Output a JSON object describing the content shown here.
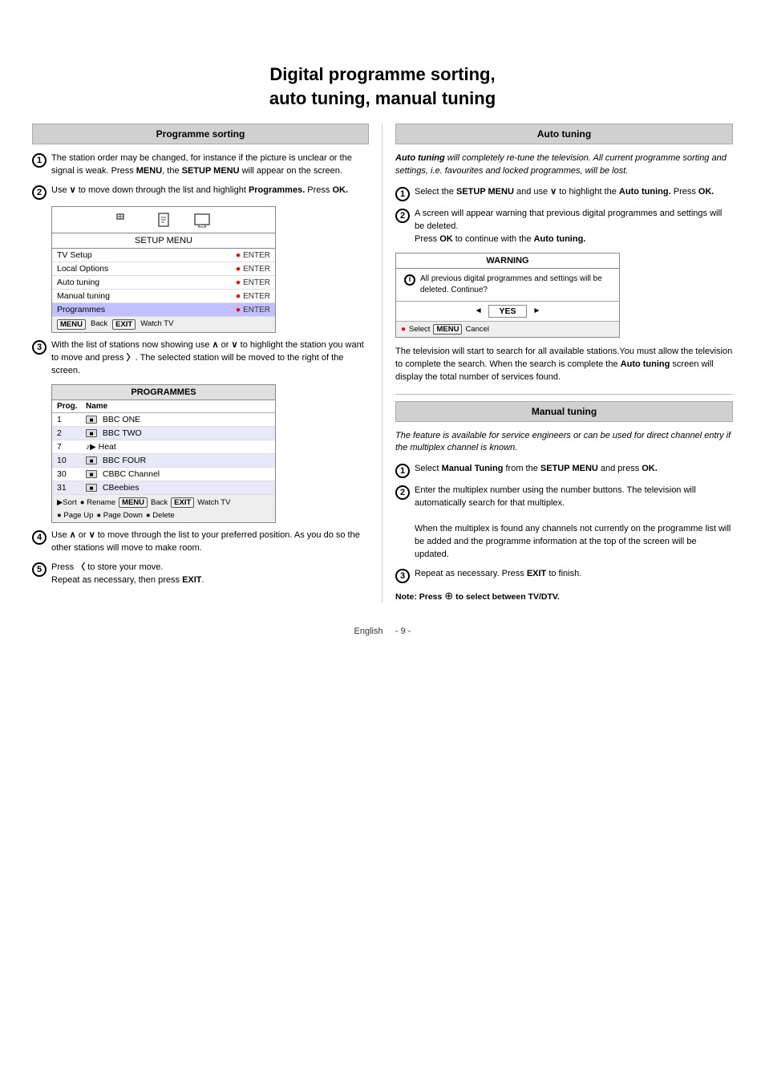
{
  "page": {
    "title_line1": "Digital  programme  sorting,",
    "title_line2": "auto  tuning,  manual  tuning"
  },
  "left_section": {
    "header": "Programme sorting",
    "step1": {
      "text_before": "The station order may be changed, for instance if the picture is unclear or the signal is weak.  Press ",
      "key1": "MENU",
      "text_mid": ", the ",
      "key2": "SETUP MENU",
      "text_after": " will appear on the screen."
    },
    "step2": {
      "text_before": "Use ",
      "chevron": "∨",
      "text_mid": " to move down through the list  and highlight ",
      "bold1": "Programmes.",
      "text_after": " Press ",
      "key": "OK",
      "text_end": "."
    },
    "menu": {
      "title": "SETUP MENU",
      "rows": [
        {
          "label": "TV Setup",
          "enter": "ENTER",
          "selected": false
        },
        {
          "label": "Local Options",
          "enter": "ENTER",
          "selected": false
        },
        {
          "label": "Auto tuning",
          "enter": "ENTER",
          "selected": false
        },
        {
          "label": "Manual tuning",
          "enter": "ENTER",
          "selected": false
        },
        {
          "label": "Programmes",
          "enter": "ENTER",
          "selected": true
        }
      ],
      "footer_items": [
        "MENU",
        "Back",
        "EXIT",
        "Watch TV"
      ]
    },
    "step3": {
      "text1": "With the list of stations now showing use ",
      "ch_up": "∧",
      "text2": " or ",
      "ch_dn": "∨",
      "text3": " to highlight the station you want to move and press ",
      "ch_rt": "〉",
      "text4": ". The selected station will be moved to the right of the screen."
    },
    "programmes": {
      "title": "PROGRAMMES",
      "col_prog": "Prog.",
      "col_name": "Name",
      "rows": [
        {
          "num": "1",
          "icon": "tv",
          "name": "BBC ONE"
        },
        {
          "num": "2",
          "icon": "tv",
          "name": "BBC TWO"
        },
        {
          "num": "7",
          "icon": "music",
          "name": "Heat"
        },
        {
          "num": "10",
          "icon": "tv",
          "name": "BBC FOUR"
        },
        {
          "num": "30",
          "icon": "tv",
          "name": "CBBC Channel"
        },
        {
          "num": "31",
          "icon": "tv",
          "name": "CBeebies"
        }
      ],
      "footer_items": [
        "▶Sort",
        "● Rename",
        "MENU Back",
        "EXIT Watch TV",
        "● Page Up",
        "● Page Down",
        "● Delete"
      ]
    },
    "step4": {
      "text1": "Use ",
      "ch_up": "∧",
      "text2": " or ",
      "ch_dn": "∨",
      "text3": " to move through the list to your preferred position. As you do so the other stations will move to make room."
    },
    "step5": {
      "text1": "Press ",
      "ch_lt": "〈",
      "text2": " to store your move.",
      "text3": "Repeat as necessary, then press ",
      "key": "EXIT",
      "text4": "."
    }
  },
  "right_section": {
    "header": "Auto tuning",
    "intro": "Auto tuning",
    "intro_rest": " will completely re-tune the television. All current programme sorting and settings, i.e. favourites and locked programmes, will be lost.",
    "step1": {
      "text1": "Select the ",
      "key1": "SETUP MENU",
      "text2": " and use ",
      "ch_dn": "∨",
      "text3": " to highlight the ",
      "bold1": "Auto tuning.",
      "text4": " Press ",
      "key2": "OK",
      "text5": "."
    },
    "step2": {
      "text1": "A screen will appear warning that previous digital programmes and settings will be deleted.",
      "text2": "Press ",
      "key": "OK",
      "text3": " to continue with the ",
      "bold": "Auto tuning."
    },
    "warning": {
      "title": "WARNING",
      "body": "All previous digital programmes and settings will be deleted. Continue?",
      "yes_label": "YES",
      "footer_select": "Select",
      "footer_menu": "MENU",
      "footer_cancel": "Cancel"
    },
    "after_warning": "The television will start to search for all available stations.You must allow the television to complete the search. When the search is complete the ",
    "after_warning_bold": "Auto tuning",
    "after_warning2": " screen will display the total number of services found.",
    "manual_header": "Manual tuning",
    "manual_intro": "The feature is available for service engineers or  can be used for direct channel entry if the multiplex channel is known.",
    "manual_step1": {
      "text1": "Select ",
      "bold1": "Manual Tuning",
      "text2": " from the ",
      "key": "SETUP MENU",
      "text3": " and press ",
      "bold2": "OK",
      "text4": "."
    },
    "manual_step2": {
      "text1": "Enter the multiplex number using the number buttons. The television will automatically search for that multiplex.",
      "text2": "When the multiplex is found any channels not currently on the programme list will be added and the programme information at the top of the screen will be updated."
    },
    "manual_step3": {
      "text1": "Repeat as necessary. Press ",
      "key": "EXIT",
      "text2": " to finish."
    },
    "note": {
      "text1": "Note: Press ",
      "icon": "⊕",
      "text2": " to select between TV/DTV."
    }
  },
  "footer": {
    "lang": "English",
    "page": "- 9 -"
  }
}
